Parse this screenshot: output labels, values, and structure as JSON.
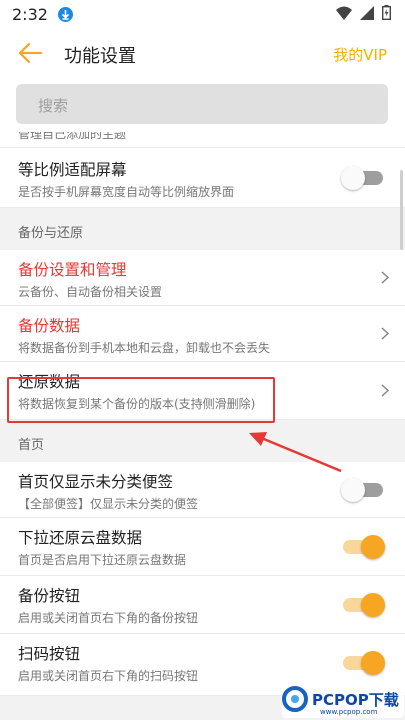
{
  "status_bar": {
    "time": "2:32"
  },
  "header": {
    "title": "功能设置",
    "vip_label": "我的VIP"
  },
  "search": {
    "placeholder": "搜索"
  },
  "colors": {
    "accent": "#f6a623",
    "danger": "#e53935",
    "vip": "#f4b000"
  },
  "rows": {
    "partial_sub": "管理自己添加的主题",
    "fit_screen": {
      "title": "等比例适配屏幕",
      "sub": "是否按手机屏幕宽度自动等比例缩放界面",
      "enabled": false
    },
    "section_backup": "备份与还原",
    "backup_settings": {
      "title": "备份设置和管理",
      "sub": "云备份、自动备份相关设置"
    },
    "backup_data": {
      "title": "备份数据",
      "sub": "将数据备份到手机本地和云盘，卸载也不会丢失"
    },
    "restore_data": {
      "title": "还原数据",
      "sub": "将数据恢复到某个备份的版本(支持侧滑删除)"
    },
    "section_home": "首页",
    "show_unclassified": {
      "title": "首页仅显示未分类便签",
      "sub": "【全部便签】仅显示未分类的便签",
      "enabled": false
    },
    "pull_restore": {
      "title": "下拉还原云盘数据",
      "sub": "首页是否启用下拉还原云盘数据",
      "enabled": true
    },
    "backup_button": {
      "title": "备份按钮",
      "sub": "启用或关闭首页右下角的备份按钮",
      "enabled": true
    },
    "scan_button": {
      "title": "扫码按钮",
      "sub": "启用或关闭首页右下角的扫码按钮",
      "enabled": true
    }
  },
  "watermark": {
    "brand": "PCPOP下载",
    "url": "www.pcpop.com"
  }
}
